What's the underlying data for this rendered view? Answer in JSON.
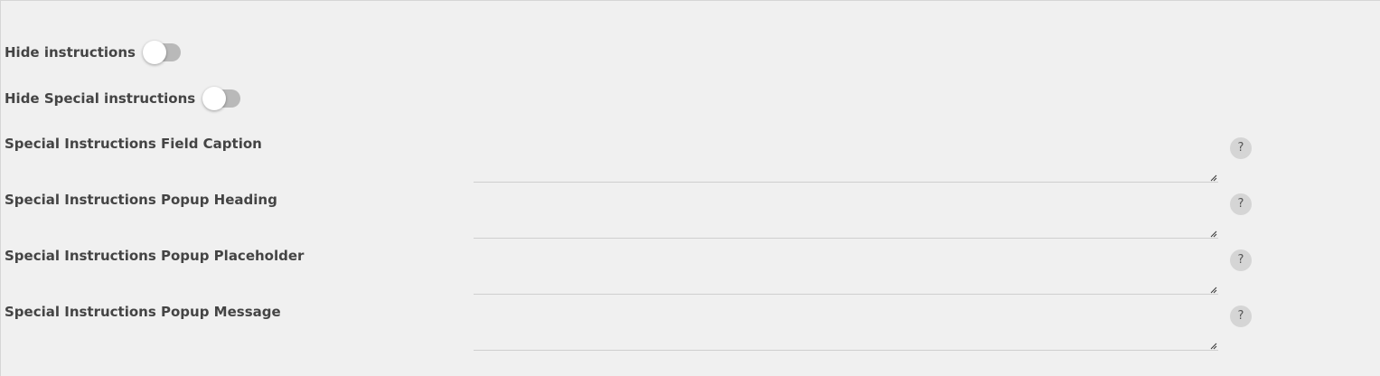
{
  "toggles": [
    {
      "label": "Hide instructions",
      "checked": false
    },
    {
      "label": "Hide Special instructions",
      "checked": false
    }
  ],
  "fields": [
    {
      "label": "Special Instructions Field Caption",
      "value": "",
      "help_icon": "?"
    },
    {
      "label": "Special Instructions Popup Heading",
      "value": "",
      "help_icon": "?"
    },
    {
      "label": "Special Instructions Popup Placeholder",
      "value": "",
      "help_icon": "?"
    },
    {
      "label": "Special Instructions Popup Message",
      "value": "",
      "help_icon": "?"
    }
  ],
  "colors": {
    "background": "#f0f0f0",
    "text": "#444444",
    "switch_track_off": "#b9b9b9",
    "help_badge": "#d5d5d5"
  }
}
